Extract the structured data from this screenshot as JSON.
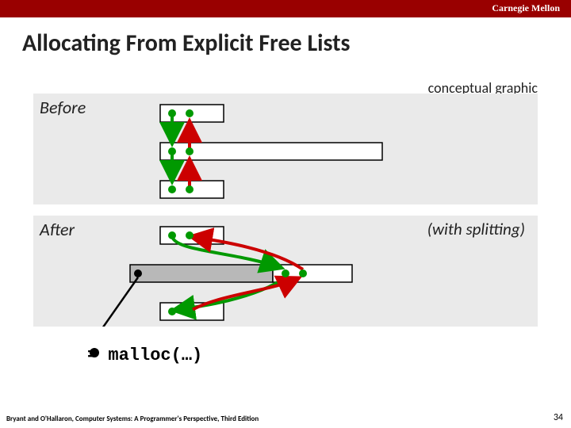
{
  "header": {
    "institution": "Carnegie Mellon"
  },
  "title": "Allocating From Explicit Free Lists",
  "annotations": {
    "conceptual": "conceptual graphic",
    "before": "Before",
    "after": "After",
    "splitting": "(with splitting)"
  },
  "malloc": {
    "code": "= malloc(…)"
  },
  "footer": {
    "citation": "Bryant and O'Hallaron, Computer Systems: A Programmer's Perspective, Third Edition",
    "page": "34"
  },
  "diagram": {
    "dot_color": "#009900",
    "arrow_green": "#009900",
    "arrow_red": "#cc0000",
    "block_fill": "#ffffff",
    "alloc_fill": "#b8b8b8"
  }
}
